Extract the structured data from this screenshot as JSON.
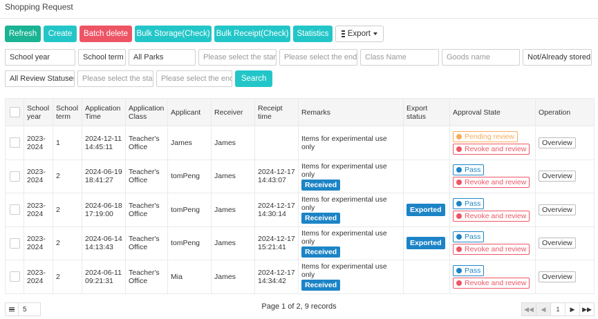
{
  "page": {
    "title": "Shopping Request"
  },
  "toolbar": {
    "refresh": "Refresh",
    "create": "Create",
    "batch_delete": "Batch delete",
    "bulk_storage": "Bulk Storage(Check)",
    "bulk_receipt": "Bulk Receipt(Check)",
    "statistics": "Statistics",
    "export": "Export"
  },
  "filters": {
    "school_year": "School year",
    "school_term": "School term",
    "parks": "All Parks",
    "start_date_ph": "Please select the start",
    "end_date_ph": "Please select the end a",
    "class_name_ph": "Class Name",
    "goods_name_ph": "Goods name",
    "stored_status": "Not/Already stored",
    "review_status": "All Review Statuses",
    "review_start_ph": "Please select the start",
    "review_end_ph": "Please select the end r",
    "search": "Search"
  },
  "table": {
    "columns": [
      "School year",
      "School term",
      "Application Time",
      "Application Class",
      "Applicant",
      "Receiver",
      "Receipt time",
      "Remarks",
      "Export status",
      "Approval State",
      "Operation"
    ],
    "rows": [
      {
        "year": "2023-2024",
        "term": "1",
        "app_time": "2024-12-11 14:45:11",
        "app_class": "Teacher's Office",
        "applicant": "James",
        "receiver": "James",
        "receipt_time": "",
        "remarks": "Items for experimental use only",
        "received": "",
        "export_status": "",
        "state1": "Pending review",
        "state2": "Revoke and review",
        "operation": "Overview"
      },
      {
        "year": "2023-2024",
        "term": "2",
        "app_time": "2024-06-19 18:41:27",
        "app_class": "Teacher's Office",
        "applicant": "tomPeng",
        "receiver": "James",
        "receipt_time": "2024-12-17 14:43:07",
        "remarks": "Items for experimental use only",
        "received": "Received",
        "export_status": "",
        "state1": "Pass",
        "state2": "Revoke and review",
        "operation": "Overview"
      },
      {
        "year": "2023-2024",
        "term": "2",
        "app_time": "2024-06-18 17:19:00",
        "app_class": "Teacher's Office",
        "applicant": "tomPeng",
        "receiver": "James",
        "receipt_time": "2024-12-17 14:30:14",
        "remarks": "Items for experimental use only",
        "received": "Received",
        "export_status": "Exported",
        "state1": "Pass",
        "state2": "Revoke and review",
        "operation": "Overview"
      },
      {
        "year": "2023-2024",
        "term": "2",
        "app_time": "2024-06-14 14:13:43",
        "app_class": "Teacher's Office",
        "applicant": "tomPeng",
        "receiver": "James",
        "receipt_time": "2024-12-17 15:21:41",
        "remarks": "Items for experimental use only",
        "received": "Received",
        "export_status": "Exported",
        "state1": "Pass",
        "state2": "Revoke and review",
        "operation": "Overview"
      },
      {
        "year": "2023-2024",
        "term": "2",
        "app_time": "2024-06-11 09:21:31",
        "app_class": "Teacher's Office",
        "applicant": "Mia",
        "receiver": "James",
        "receipt_time": "2024-12-17 14:34:42",
        "remarks": "Items for experimental use only",
        "received": "Received",
        "export_status": "",
        "state1": "Pass",
        "state2": "Revoke and review",
        "operation": "Overview"
      }
    ]
  },
  "footer": {
    "page_size": "5",
    "page_info": "Page 1 of 2, 9 records",
    "current_page": "1"
  },
  "icons": {
    "export": "list-icon",
    "page_size": "list-icon",
    "first": "first-page-icon",
    "prev": "prev-page-icon",
    "next": "next-page-icon",
    "last": "last-page-icon"
  },
  "colors": {
    "green": "#1ab394",
    "teal": "#23c6c8",
    "red": "#ed5565",
    "blue": "#1c84c6",
    "orange": "#f8ac59"
  }
}
